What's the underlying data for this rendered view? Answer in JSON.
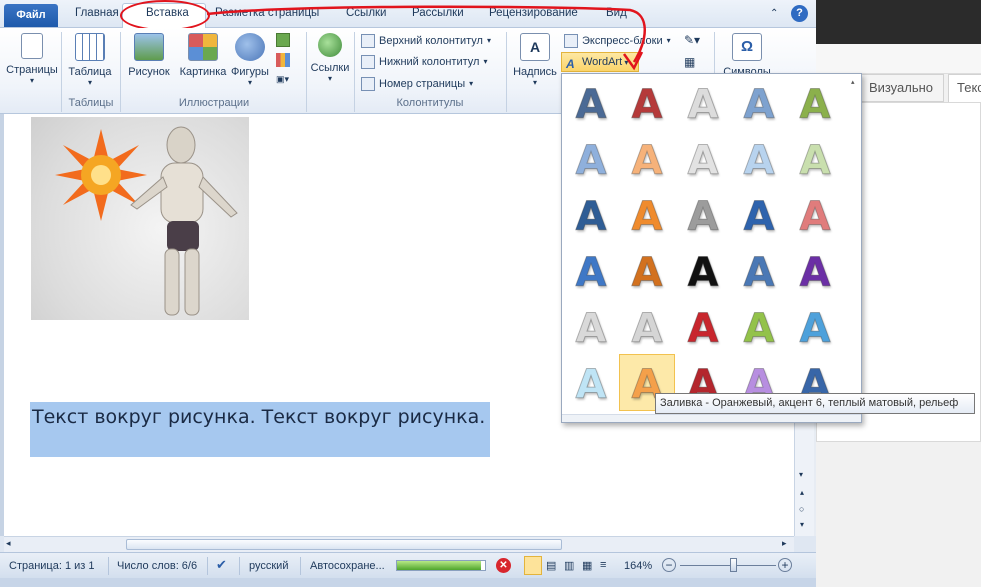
{
  "tabs": {
    "file": "Файл",
    "items": [
      "Главная",
      "Вставка",
      "Разметка страницы",
      "Ссылки",
      "Рассылки",
      "Рецензирование",
      "Вид"
    ],
    "active": "Вставка"
  },
  "ribbon": {
    "pages": "Страницы",
    "table": "Таблица",
    "tables_group": "Таблицы",
    "picture": "Рисунок",
    "clipart": "Картинка",
    "shapes": "Фигуры",
    "illustrations_group": "Иллюстрации",
    "links": "Ссылки",
    "header": "Верхний колонтитул",
    "footer": "Нижний колонтитул",
    "page_number": "Номер страницы",
    "headers_group": "Колонтитулы",
    "textbox": "Надпись",
    "quickparts": "Экспресс-блоки",
    "wordart": "WordArt",
    "symbols": "Символы",
    "omega": "Ω"
  },
  "document": {
    "selected_text": "Текст вокруг рисунка. Текст вокруг рисунка."
  },
  "gallery": {
    "letter": "A",
    "rows": [
      [
        "#4b6a95",
        "#b53a3a",
        "#dcdcdc",
        "#7ea2cf",
        "#8bb04c"
      ],
      [
        "#8fb0dc",
        "#f6b27a",
        "#e2e2e2",
        "#b8d3ee",
        "#c9dfae"
      ],
      [
        "#2f5d95",
        "#ef8b2d",
        "#9c9c9c",
        "#2e63ad",
        "#e07c7c"
      ],
      [
        "#3f78c6",
        "#d2711f",
        "#111111",
        "#4a78b5",
        "#6b2fa5"
      ],
      [
        "#d9d9d9",
        "#d5d5d5",
        "#c8262d",
        "#93c24a",
        "#4ea1db"
      ],
      [
        "#bfe4f5",
        "#f4a04a",
        "#b4262d",
        "#b78ee0",
        "#3866a8"
      ]
    ],
    "tooltip": "Заливка - Оранжевый, акцент 6, теплый матовый, рельеф"
  },
  "status": {
    "page": "Страница: 1 из 1",
    "words": "Число слов: 6/6",
    "language": "русский",
    "autosave": "Автосохране...",
    "autosave_progress": 0.95,
    "zoom": "164%"
  },
  "side_editor": {
    "visual_tab": "Визуально",
    "text_tab": "Текс"
  },
  "icons": [
    "help-icon",
    "minimize-ribbon-icon",
    "cancel-icon",
    "zoom-out-icon",
    "zoom-in-icon"
  ]
}
